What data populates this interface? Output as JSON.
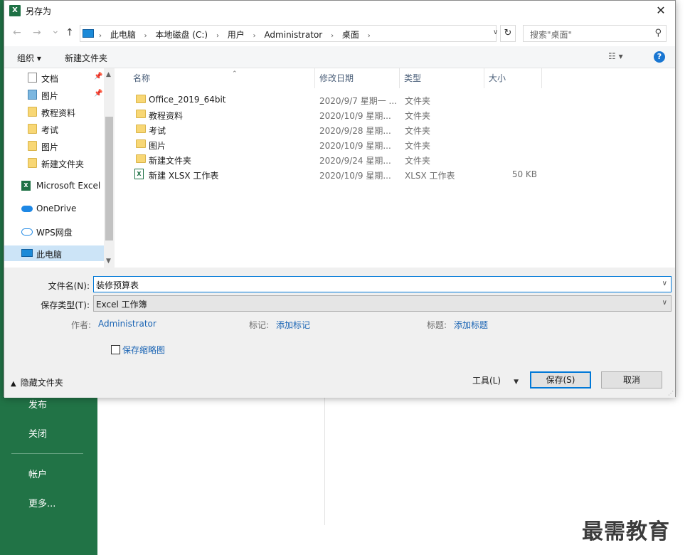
{
  "window": {
    "title": "另存为",
    "close_glyph": "✕"
  },
  "navigation": {
    "back_glyph": "←",
    "forward_glyph": "→",
    "recent_glyph": "⌄",
    "up_glyph": "↑",
    "breadcrumbs": [
      "此电脑",
      "本地磁盘 (C:)",
      "用户",
      "Administrator",
      "桌面"
    ],
    "crumb_sep": "›",
    "refresh_glyph": "↻",
    "search_placeholder": "搜索\"桌面\"",
    "search_glyph": "⚲"
  },
  "toolbar": {
    "organize_label": "组织 ▾",
    "new_folder_label": "新建文件夹",
    "view_glyph": "☷ ▾",
    "help_glyph": "?"
  },
  "sidebar": {
    "items": [
      {
        "label": "文档",
        "icon": "document-icon",
        "pinned": true
      },
      {
        "label": "图片",
        "icon": "picture-icon",
        "pinned": true
      },
      {
        "label": "教程资料",
        "icon": "folder-icon",
        "pinned": false
      },
      {
        "label": "考试",
        "icon": "folder-icon",
        "pinned": false
      },
      {
        "label": "图片",
        "icon": "folder-icon",
        "pinned": false
      },
      {
        "label": "新建文件夹",
        "icon": "folder-icon",
        "pinned": false
      },
      {
        "label": "Microsoft Excel",
        "icon": "excel-icon",
        "pinned": false
      },
      {
        "label": "OneDrive",
        "icon": "onedrive-icon",
        "pinned": false
      },
      {
        "label": "WPS网盘",
        "icon": "wps-cloud-icon",
        "pinned": false
      },
      {
        "label": "此电脑",
        "icon": "this-pc-icon",
        "pinned": false,
        "selected": true
      }
    ],
    "pin_glyph": "📌",
    "scroll_up_glyph": "▲",
    "scroll_down_glyph": "▼"
  },
  "file_list": {
    "columns": [
      "名称",
      "修改日期",
      "类型",
      "大小"
    ],
    "sort_glyph": "⌃",
    "rows": [
      {
        "name": "Office_2019_64bit",
        "date": "2020/9/7 星期一 ...",
        "type": "文件夹",
        "size": "",
        "icon": "folder-icon"
      },
      {
        "name": "教程资料",
        "date": "2020/10/9 星期...",
        "type": "文件夹",
        "size": "",
        "icon": "folder-icon"
      },
      {
        "name": "考试",
        "date": "2020/9/28 星期...",
        "type": "文件夹",
        "size": "",
        "icon": "folder-icon"
      },
      {
        "name": "图片",
        "date": "2020/10/9 星期...",
        "type": "文件夹",
        "size": "",
        "icon": "folder-icon"
      },
      {
        "name": "新建文件夹",
        "date": "2020/9/24 星期...",
        "type": "文件夹",
        "size": "",
        "icon": "folder-icon"
      },
      {
        "name": "新建 XLSX 工作表",
        "date": "2020/10/9 星期...",
        "type": "XLSX 工作表",
        "size": "50 KB",
        "icon": "xlsx-file-icon"
      }
    ]
  },
  "form": {
    "filename_label": "文件名(N):",
    "filename_value": "装修预算表",
    "filetype_label": "保存类型(T):",
    "filetype_value": "Excel 工作簿",
    "author_label": "作者:",
    "author_value": "Administrator",
    "tags_label": "标记:",
    "tags_value": "添加标记",
    "title_label": "标题:",
    "title_value": "添加标题",
    "thumbnail_label": "保存缩略图",
    "hide_folders_label": "隐藏文件夹",
    "hide_folders_glyph": "▲",
    "tools_label": "工具(L)",
    "tools_glyph": "▼",
    "save_label": "保存(S)",
    "cancel_label": "取消",
    "dd_glyph": "∨"
  },
  "background": {
    "menu": [
      "发布",
      "关闭",
      "帐户",
      "更多..."
    ],
    "watermark": "最需教育"
  },
  "colors": {
    "excel_green": "#217346",
    "accent_blue": "#0078d7",
    "selected_bg": "#cce4f7",
    "link_blue": "#1a64b4"
  }
}
